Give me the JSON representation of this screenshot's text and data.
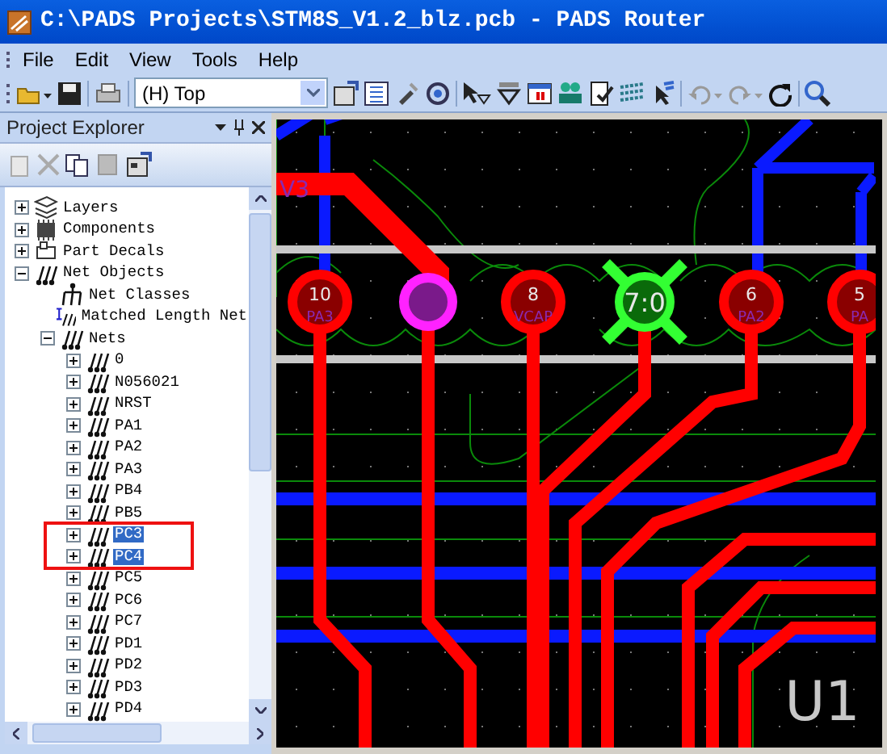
{
  "window": {
    "title": "C:\\PADS Projects\\STM8S_V1.2_blz.pcb - PADS Router"
  },
  "menu": [
    {
      "label": "File"
    },
    {
      "label": "Edit"
    },
    {
      "label": "View"
    },
    {
      "label": "Tools"
    },
    {
      "label": "Help"
    }
  ],
  "toolbar": {
    "layer_select": {
      "value": "(H) Top"
    }
  },
  "project_explorer": {
    "title": "Project Explorer",
    "tree": [
      {
        "label": "Layers",
        "kind": "layers",
        "expanded": false,
        "selected": false
      },
      {
        "label": "Components",
        "kind": "component",
        "expanded": false,
        "selected": false
      },
      {
        "label": "Part Decals",
        "kind": "decal",
        "expanded": false,
        "selected": false
      },
      {
        "label": "Net Objects",
        "kind": "net",
        "expanded": true,
        "selected": false,
        "children": [
          {
            "label": "Net Classes",
            "kind": "netclass",
            "selected": false
          },
          {
            "label": "Matched Length Net",
            "kind": "matched",
            "selected": false
          },
          {
            "label": "Nets",
            "kind": "net",
            "expanded": true,
            "selected": false,
            "children": [
              {
                "label": "0",
                "kind": "net",
                "expanded": false,
                "selected": false
              },
              {
                "label": "N056021",
                "kind": "net",
                "expanded": false,
                "selected": false
              },
              {
                "label": "NRST",
                "kind": "net",
                "expanded": false,
                "selected": false
              },
              {
                "label": "PA1",
                "kind": "net",
                "expanded": false,
                "selected": false
              },
              {
                "label": "PA2",
                "kind": "net",
                "expanded": false,
                "selected": false
              },
              {
                "label": "PA3",
                "kind": "net",
                "expanded": false,
                "selected": false
              },
              {
                "label": "PB4",
                "kind": "net",
                "expanded": false,
                "selected": false
              },
              {
                "label": "PB5",
                "kind": "net",
                "expanded": false,
                "selected": false
              },
              {
                "label": "PC3",
                "kind": "net",
                "expanded": false,
                "selected": true
              },
              {
                "label": "PC4",
                "kind": "net",
                "expanded": false,
                "selected": true
              },
              {
                "label": "PC5",
                "kind": "net",
                "expanded": false,
                "selected": false
              },
              {
                "label": "PC6",
                "kind": "net",
                "expanded": false,
                "selected": false
              },
              {
                "label": "PC7",
                "kind": "net",
                "expanded": false,
                "selected": false
              },
              {
                "label": "PD1",
                "kind": "net",
                "expanded": false,
                "selected": false
              },
              {
                "label": "PD2",
                "kind": "net",
                "expanded": false,
                "selected": false
              },
              {
                "label": "PD3",
                "kind": "net",
                "expanded": false,
                "selected": false
              },
              {
                "label": "PD4",
                "kind": "net",
                "expanded": false,
                "selected": false
              }
            ]
          }
        ]
      }
    ]
  },
  "pcb": {
    "trace_label": "V3",
    "component_label": "U1",
    "pins": [
      {
        "number": "10",
        "name": "PA3",
        "kind": "pad"
      },
      {
        "kind": "via"
      },
      {
        "number": "8",
        "name": "VCAP",
        "kind": "pad"
      },
      {
        "number": "7:0",
        "kind": "selected"
      },
      {
        "number": "6",
        "name": "PA2",
        "kind": "pad"
      },
      {
        "number": "5",
        "name": "PA",
        "kind": "pad"
      }
    ]
  }
}
